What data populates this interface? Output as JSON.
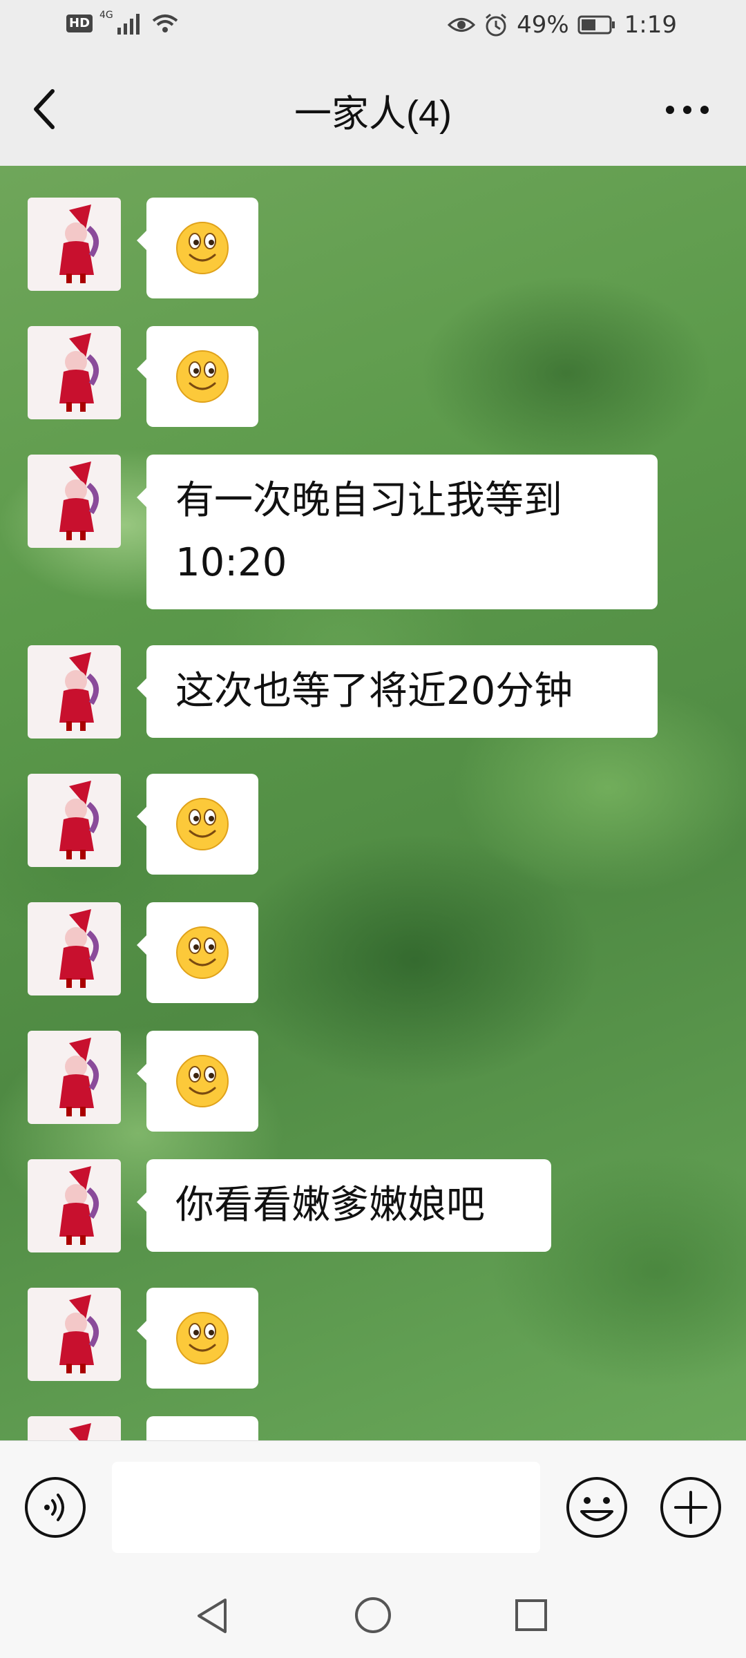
{
  "status_bar": {
    "hd": "HD",
    "network": "4G",
    "battery": "49%",
    "time": "1:19"
  },
  "header": {
    "title": "一家人(4)"
  },
  "messages": [
    {
      "type": "emoji"
    },
    {
      "type": "emoji"
    },
    {
      "type": "text",
      "line1": "有一次晚自习让我等到",
      "line2": "10:20"
    },
    {
      "type": "text",
      "line1": "这次也等了将近20分钟"
    },
    {
      "type": "emoji"
    },
    {
      "type": "emoji"
    },
    {
      "type": "emoji"
    },
    {
      "type": "text",
      "line1": "你看看嫩爹嫩娘吧"
    },
    {
      "type": "emoji"
    },
    {
      "type": "emoji"
    }
  ],
  "input": {
    "value": ""
  },
  "icons": {
    "back": "chevron-left-icon",
    "more": "more-dots-icon",
    "voice": "voice-icon",
    "emoji": "smile-icon",
    "plus": "plus-icon"
  }
}
